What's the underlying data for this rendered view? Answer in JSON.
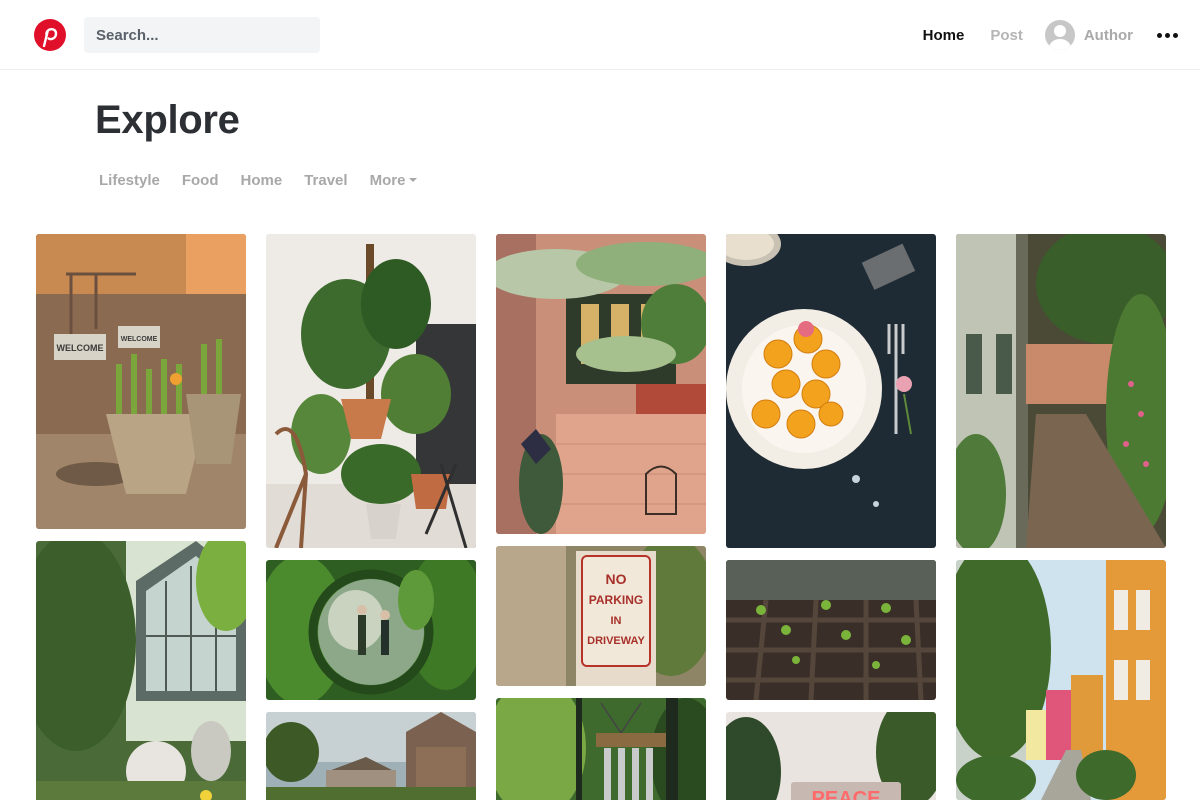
{
  "header": {
    "search_placeholder": "Search...",
    "nav": {
      "home": "Home",
      "post": "Post",
      "author": "Author"
    },
    "brand_color": "#e0102b"
  },
  "page": {
    "title": "Explore",
    "categories": [
      "Lifestyle",
      "Food",
      "Home",
      "Travel",
      "More"
    ]
  },
  "photos": {
    "signs": [
      "WELCOME",
      "WELCOME",
      "NO PARKING IN DRIVEWAY",
      "PEACE"
    ]
  }
}
